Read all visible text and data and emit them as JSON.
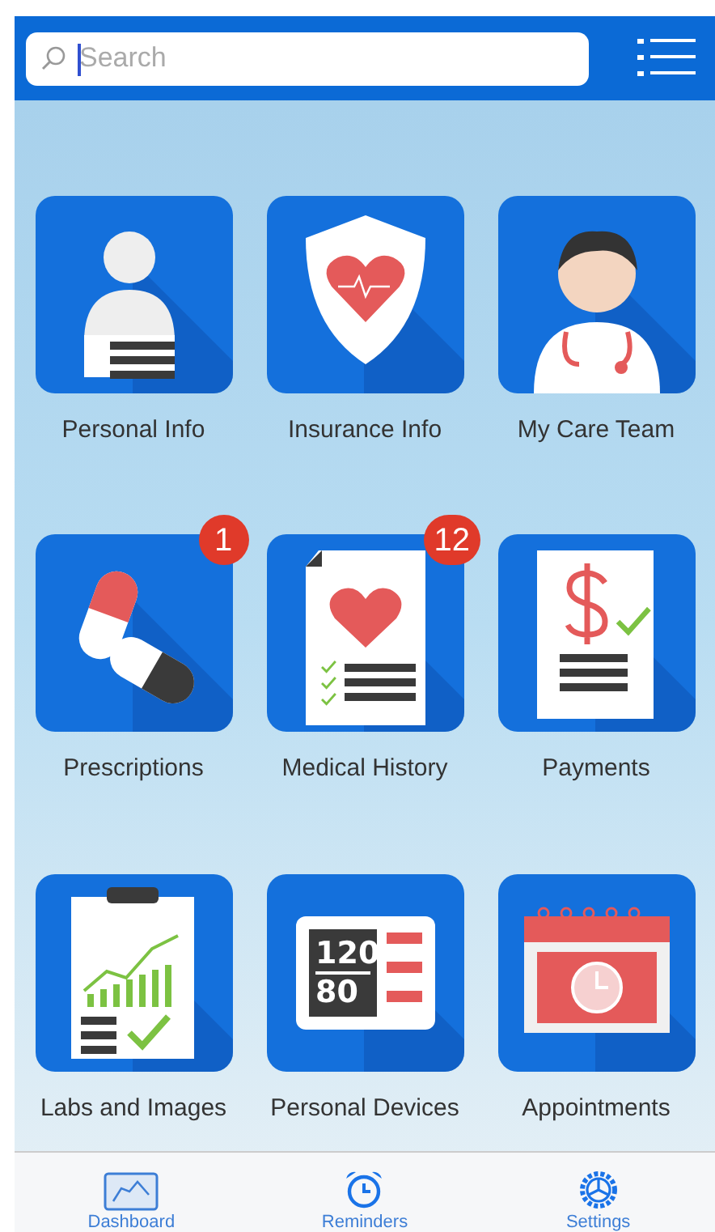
{
  "search": {
    "placeholder": "Search"
  },
  "tiles": [
    {
      "kind": "person",
      "label": "Personal Info"
    },
    {
      "kind": "shield",
      "label": "Insurance Info"
    },
    {
      "kind": "doctor",
      "label": "My Care Team"
    },
    {
      "kind": "pills",
      "label": "Prescriptions",
      "badge": "1"
    },
    {
      "kind": "record",
      "label": "Medical History",
      "badge": "12"
    },
    {
      "kind": "receipt",
      "label": "Payments"
    },
    {
      "kind": "chart",
      "label": "Labs and Images"
    },
    {
      "kind": "monitor",
      "label": "Personal Devices",
      "readings": [
        "120",
        "80"
      ]
    },
    {
      "kind": "calendar",
      "label": "Appointments"
    }
  ],
  "tabs": [
    {
      "kind": "dashboard",
      "label": "Dashboard"
    },
    {
      "kind": "alarm",
      "label": "Reminders"
    },
    {
      "kind": "gear",
      "label": "Settings"
    }
  ]
}
